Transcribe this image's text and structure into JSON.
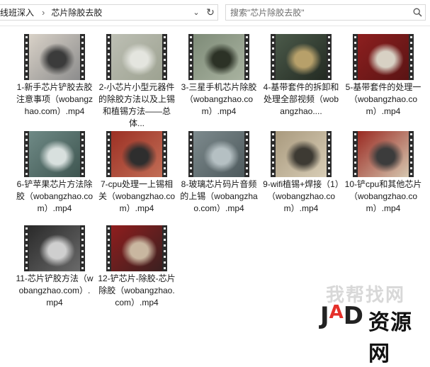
{
  "breadcrumb": {
    "parent": "线班深入",
    "current": "芯片除胶去胶"
  },
  "search": {
    "placeholder": "搜索\"芯片除胶去胶\""
  },
  "files": [
    {
      "name": "1-新手芯片铲胶去胶注意事项（wobangzhao.com）.mp4",
      "colors": [
        "#d9d2c8",
        "#3b3b3b",
        "#8c8c8c"
      ]
    },
    {
      "name": "2-小芯片小型元器件的除胶方法以及上锡和植锡方法——总体...",
      "colors": [
        "#bdbfb4",
        "#e4e5df",
        "#9da291"
      ]
    },
    {
      "name": "3-三星手机芯片除胶（wobangzhao.com）.mp4",
      "colors": [
        "#7e8b78",
        "#2c3226",
        "#a9b3a0"
      ]
    },
    {
      "name": "4-基带套件的拆卸和处理全部视频（wobangzhao....",
      "colors": [
        "#4b5a4a",
        "#b7a06a",
        "#232a22"
      ]
    },
    {
      "name": "5-基带套件的处理一（wobangzhao.com）.mp4",
      "colors": [
        "#8d1f1f",
        "#d8d1c4",
        "#5a1414"
      ]
    },
    {
      "name": "6-铲苹果芯片方法除胶（wobangzhao.com）.mp4",
      "colors": [
        "#6f8a86",
        "#d8e0de",
        "#3e5550"
      ]
    },
    {
      "name": "7-cpu处理一上锡相关（wobangzhao.com）.mp4",
      "colors": [
        "#9c3024",
        "#2e2e2e",
        "#c26e56"
      ]
    },
    {
      "name": "8-玻璃芯片码片音频的上锡（wobangzhao.com）.mp4",
      "colors": [
        "#7d8a8d",
        "#b5c0c3",
        "#4d595c"
      ]
    },
    {
      "name": "9-wifi植锡+焊接（1）（wobangzhao.com）.mp4",
      "colors": [
        "#a99a7e",
        "#3d3a33",
        "#d8cdb6"
      ]
    },
    {
      "name": "10-铲cpu和其他芯片（wobangzhao.com）.mp4",
      "colors": [
        "#9a2a22",
        "#3c3c3c",
        "#d6c7b0"
      ]
    },
    {
      "name": "11-芯片铲胶方法（wobangzhao.com）.mp4",
      "colors": [
        "#2a2a2a",
        "#cfcfcf",
        "#6a6a6a"
      ]
    },
    {
      "name": "12-铲芯片-除胶-芯片除胶（wobangzhao.com）.mp4",
      "colors": [
        "#8f1e1e",
        "#c9b7a0",
        "#3a2020"
      ]
    }
  ],
  "watermark": {
    "top": "我帮找网",
    "logo_j": "J",
    "logo_a": "A",
    "logo_p": "D",
    "text": "资源网"
  }
}
